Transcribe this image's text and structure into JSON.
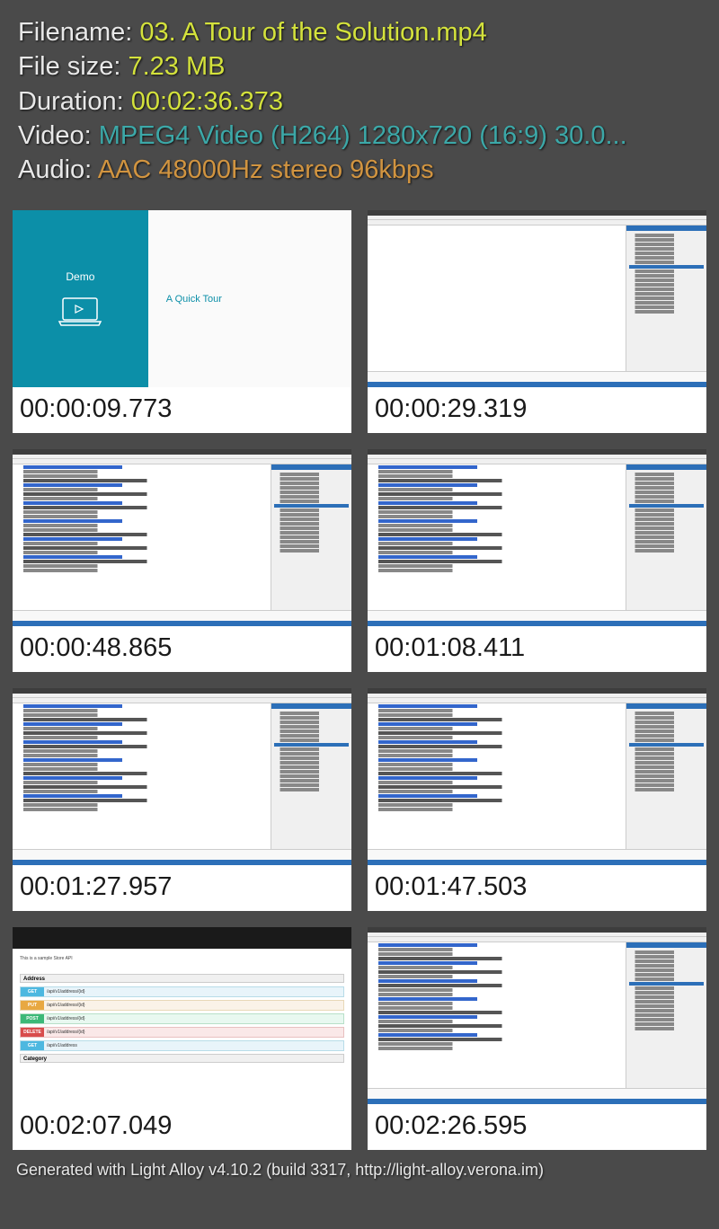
{
  "meta": {
    "filename_label": "Filename: ",
    "filename_value": "03. A Tour of the Solution.mp4",
    "filesize_label": "File size: ",
    "filesize_value": "7.23 MB",
    "duration_label": "Duration: ",
    "duration_value": "00:02:36.373",
    "video_label": "Video: ",
    "video_value": "MPEG4 Video (H264) 1280x720 (16:9) 30.0...",
    "audio_label": "Audio: ",
    "audio_value": "AAC 48000Hz stereo 96kbps"
  },
  "thumbs": [
    {
      "ts": "00:00:09.773",
      "type": "demo",
      "demo_title": "Demo",
      "demo_text": "A Quick Tour"
    },
    {
      "ts": "00:00:29.319",
      "type": "ide-empty"
    },
    {
      "ts": "00:00:48.865",
      "type": "ide-code"
    },
    {
      "ts": "00:01:08.411",
      "type": "ide-code"
    },
    {
      "ts": "00:01:27.957",
      "type": "ide-code"
    },
    {
      "ts": "00:01:47.503",
      "type": "ide-code"
    },
    {
      "ts": "00:02:07.049",
      "type": "swagger",
      "swagger_intro": "This is a sample Store API",
      "swagger_section1": "Address",
      "swagger_section2": "Category",
      "swagger_rows": [
        {
          "method": "GET",
          "cls": "get",
          "path": "/api/v1/address/{id}"
        },
        {
          "method": "PUT",
          "cls": "put",
          "path": "/api/v1/address/{id}"
        },
        {
          "method": "POST",
          "cls": "post",
          "path": "/api/v1/address/{id}"
        },
        {
          "method": "DELETE",
          "cls": "delete",
          "path": "/api/v1/address/{id}"
        },
        {
          "method": "GET",
          "cls": "get",
          "path": "/api/v1/address"
        }
      ]
    },
    {
      "ts": "00:02:26.595",
      "type": "ide-code"
    }
  ],
  "footer": "Generated with Light Alloy v4.10.2 (build 3317, http://light-alloy.verona.im)"
}
